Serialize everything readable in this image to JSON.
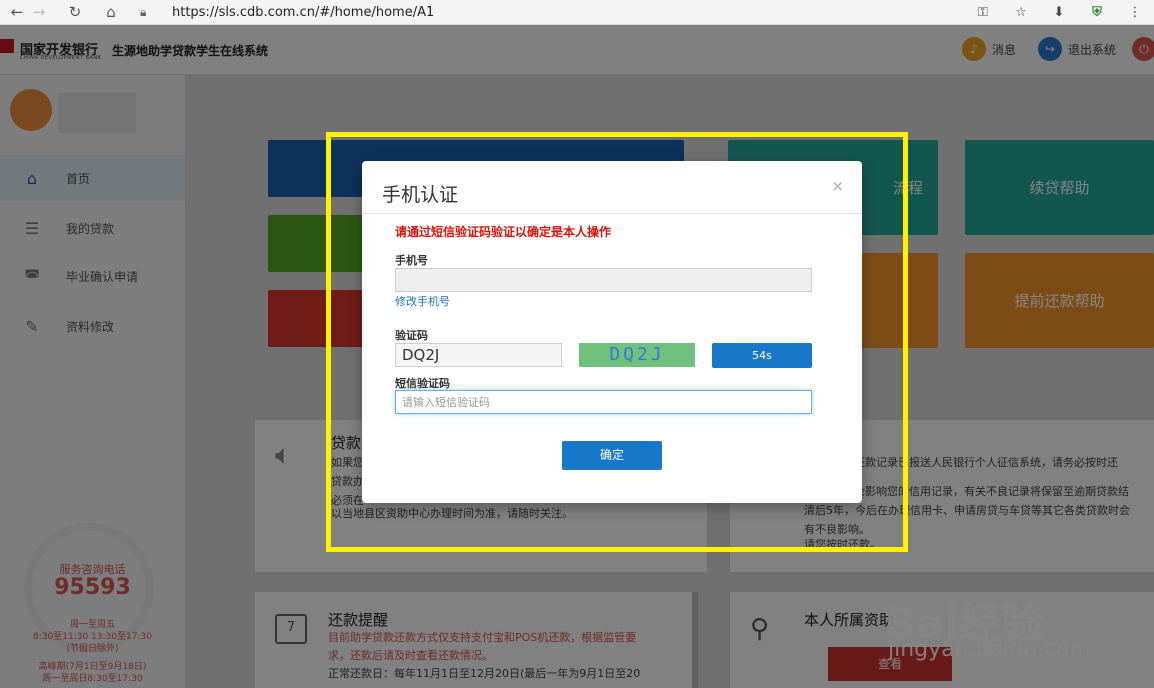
{
  "browser": {
    "url": "https://sls.cdb.com.cn/#/home/home/A1"
  },
  "header": {
    "bank_name": "国家开发银行",
    "bank_name_en": "CHINA DEVELOPMENT BANK",
    "system_name": "生源地助学贷款学生在线系统",
    "messages_label": "消息",
    "logout_label": "退出系统"
  },
  "sidebar": {
    "items": [
      {
        "label": "首页",
        "icon": "home-icon"
      },
      {
        "label": "我的贷款",
        "icon": "list-icon"
      },
      {
        "label": "毕业确认申请",
        "icon": "graduation-icon"
      },
      {
        "label": "资料修改",
        "icon": "edit-icon"
      }
    ],
    "hotline_label": "服务咨询电话",
    "hotline_number": "95593",
    "hours_1": "周一至周五",
    "hours_2": "8:30至11:30 13:30至17:30",
    "hours_3": "(节假日除外)",
    "peak_1": "高峰期(7月1日至9月18日)",
    "peak_2": "周一至周日8:30至17:30"
  },
  "tiles": {
    "loan_process": "流程",
    "renewal_help": "续贷帮助",
    "prepay_help": "提前还款帮助"
  },
  "notice": {
    "title": "贷款",
    "line1": "如果您",
    "line2": "贷款办",
    "line3": "必须在",
    "line4": "以当地县区资助中心办理时间为准，请随时关注。"
  },
  "credit": {
    "line1": "还款记录已报送人民银行个人征信系统，请务必按时还",
    "line2": "会影响您的信用记录，有关不良记录将保留至逾期贷款结",
    "line3": "清后5年，今后在办理信用卡、申请房贷与车贷等其它各类贷款时会",
    "line4": "有不良影响。",
    "line5": "请您按时还款。"
  },
  "repay": {
    "title": "还款提醒",
    "line1": "目前助学贷款还款方式仅支持支付宝和POS机还款，根据监管要",
    "line2": "求，还款后请及时查看还款情况。",
    "line3": "正常还款日：每年11月1日至12月20日(最后一年为9月1日至20",
    "calendar_day": "7"
  },
  "funding": {
    "title": "本人所属资助",
    "button_label": "查看"
  },
  "modal": {
    "title": "手机认证",
    "close": "×",
    "warning": "请通过短信验证码验证以确定是本人操作",
    "phone_label": "手机号",
    "phone_value": "",
    "change_phone_link": "修改手机号",
    "captcha_label": "验证码",
    "captcha_value": "DQ2J",
    "captcha_image_text": "DQ2J",
    "countdown_label": "54s",
    "sms_label": "短信验证码",
    "sms_placeholder": "请输入短信验证码",
    "confirm_label": "确定"
  },
  "watermark": {
    "brand": "Bai经验",
    "url": "jingyan.baidu.com"
  },
  "colors": {
    "highlight": "#fff200",
    "primary_button": "#1777c9",
    "warning_text": "#d7140e"
  }
}
